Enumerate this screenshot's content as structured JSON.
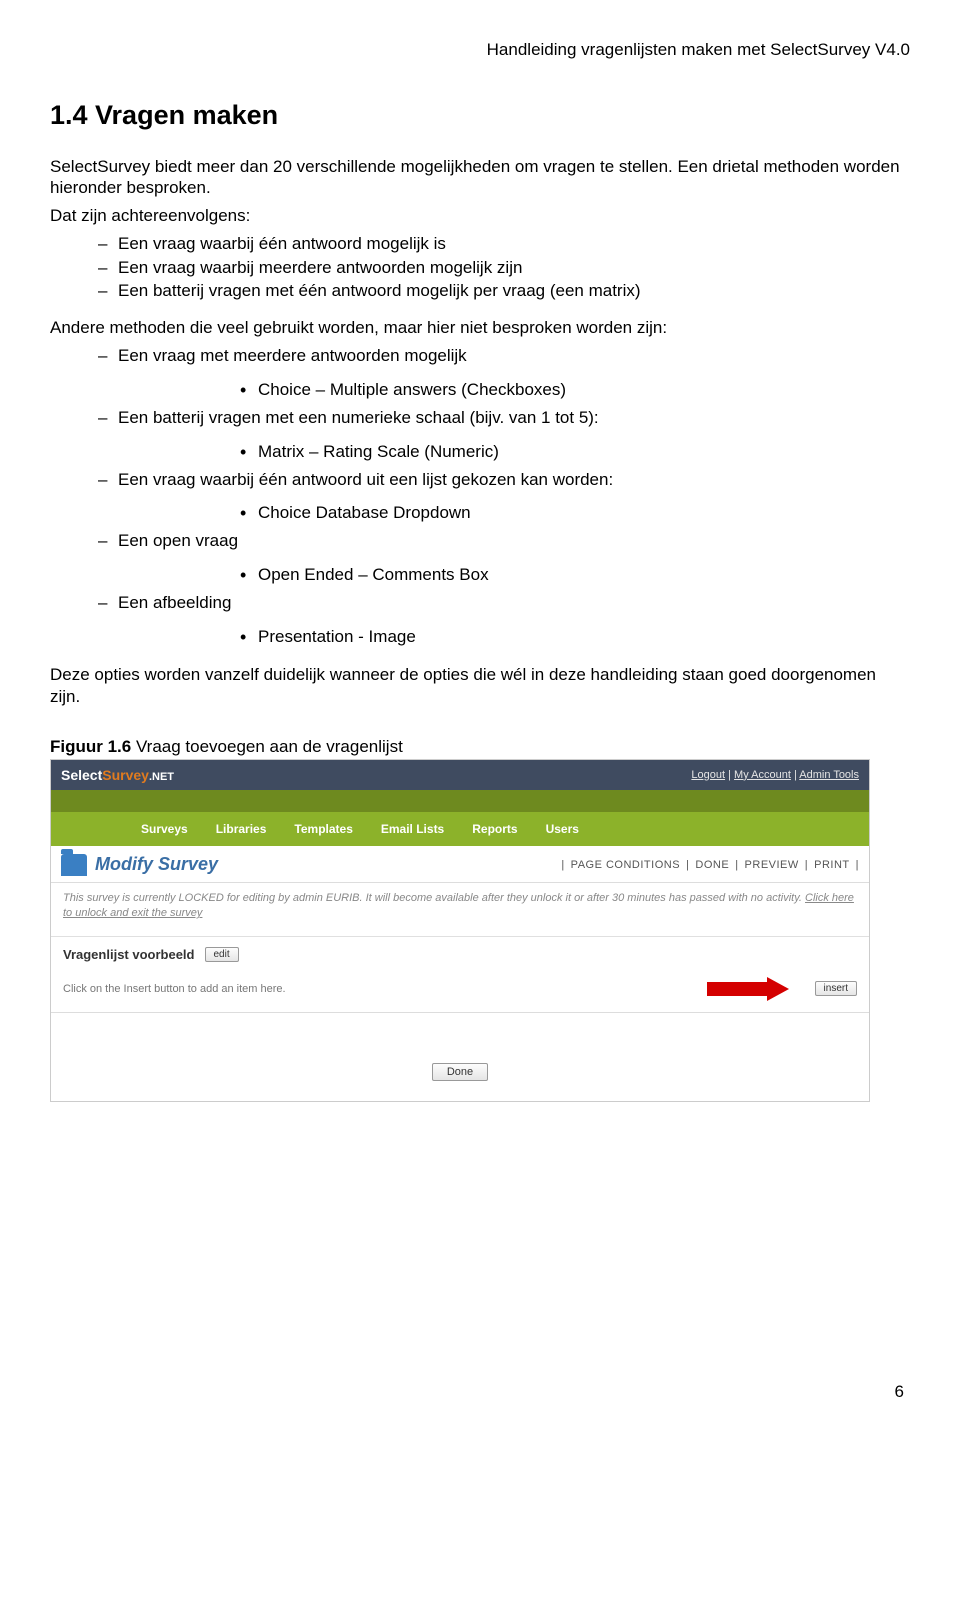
{
  "header": {
    "running": "Handleiding vragenlijsten maken met SelectSurvey V4.0"
  },
  "section": {
    "title": "1.4 Vragen maken",
    "intro": "SelectSurvey biedt meer dan 20 verschillende mogelijkheden om vragen te stellen. Een drietal methoden worden hieronder besproken.",
    "lead1": "Dat zijn achtereenvolgens:",
    "list1": [
      "Een vraag waarbij één antwoord mogelijk is",
      "Een vraag waarbij meerdere antwoorden mogelijk zijn",
      "Een batterij vragen met één antwoord mogelijk per vraag (een matrix)"
    ],
    "lead2": "Andere methoden die veel gebruikt worden, maar hier niet besproken worden zijn:",
    "list2": [
      {
        "dash": "Een vraag met meerdere antwoorden mogelijk",
        "bullet": "Choice – Multiple answers (Checkboxes)"
      },
      {
        "dash": "Een batterij vragen met een numerieke schaal (bijv. van 1 tot 5):",
        "bullet": "Matrix – Rating Scale (Numeric)"
      },
      {
        "dash": "Een vraag waarbij één antwoord uit een lijst gekozen kan worden:",
        "bullet": "Choice Database Dropdown"
      },
      {
        "dash": "Een open vraag",
        "bullet": "Open Ended – Comments Box"
      },
      {
        "dash": "Een afbeelding",
        "bullet": "Presentation - Image"
      }
    ],
    "outro": "Deze opties worden vanzelf duidelijk wanneer de opties die wél in deze handleiding staan goed doorgenomen zijn."
  },
  "figure": {
    "label_bold": "Figuur 1.6",
    "label_rest": " Vraag toevoegen aan de vragenlijst"
  },
  "screenshot": {
    "brand_select": "Select",
    "brand_survey": "Survey",
    "brand_net": ".NET",
    "toplinks": [
      "Logout",
      "My Account",
      "Admin Tools"
    ],
    "nav": [
      "Surveys",
      "Libraries",
      "Templates",
      "Email Lists",
      "Reports",
      "Users"
    ],
    "page_title": "Modify Survey",
    "right_actions": [
      "PAGE CONDITIONS",
      "DONE",
      "PREVIEW",
      "PRINT"
    ],
    "lock_msg_1": "This survey is currently LOCKED for editing by admin EURIB. It will become available after they unlock it or after 30 minutes has passed with no activity. ",
    "lock_msg_link": "Click here to unlock and exit the survey",
    "ql_label": "Vragenlijst voorbeeld",
    "edit_btn": "edit",
    "hint": "Click on the Insert button to add an item here.",
    "insert_btn": "insert",
    "done_btn": "Done"
  },
  "page_number": "6"
}
